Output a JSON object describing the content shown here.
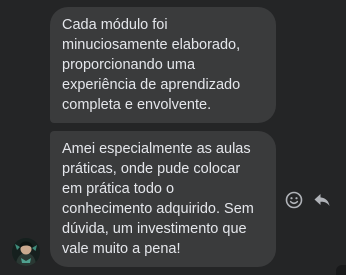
{
  "messages": [
    {
      "text": "Cada módulo foi\nminuciosamente elaborado,\nproporcionando uma\nexperiência de aprendizado\ncompleta e envolvente."
    },
    {
      "text": "Amei especialmente as aulas\npráticas, onde pude colocar\nem prática todo o\nconhecimento adquirido. Sem\ndúvida, um investimento que\nvale muito a pena!"
    }
  ],
  "actions": {
    "react_icon": "smiley-face-icon",
    "reply_icon": "reply-arrow-icon"
  },
  "colors": {
    "background": "#242526",
    "bubble": "#3a3b3c",
    "text": "#e4e6eb",
    "icon": "#b0b3b8"
  }
}
